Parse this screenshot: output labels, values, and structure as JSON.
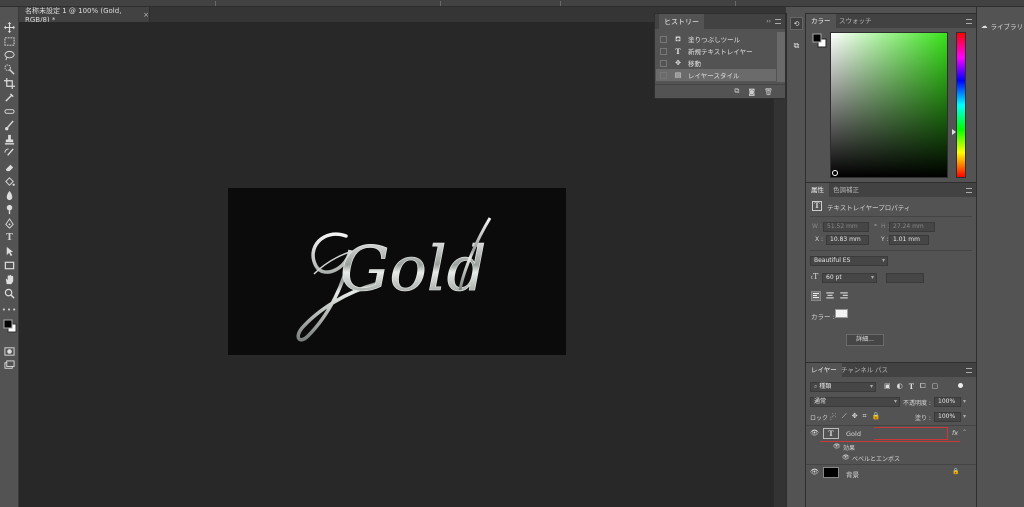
{
  "document": {
    "tab_title": "名称未設定 1 @ 100% (Gold, RGB/8) *",
    "close_label": "×",
    "text": "Gold"
  },
  "history": {
    "title": "ヒストリー",
    "items": [
      {
        "label": "塗りつぶしツール",
        "icon": "paint-bucket-icon"
      },
      {
        "label": "新規テキストレイヤー",
        "icon": "type-icon"
      },
      {
        "label": "移動",
        "icon": "move-icon"
      },
      {
        "label": "レイヤースタイル",
        "icon": "layer-style-icon"
      }
    ]
  },
  "color_panel": {
    "tabs": [
      "カラー",
      "スウォッチ"
    ],
    "hue": "#39e31a"
  },
  "properties": {
    "tabs": [
      "属性",
      "色調補正"
    ],
    "subtitle": "テキストレイヤープロパティ",
    "w_label": "W :",
    "w_value": "51.52 mm",
    "h_label": "H :",
    "h_value": "27.24 mm",
    "x_label": "X :",
    "x_value": "10.83 mm",
    "y_label": "Y :",
    "y_value": "1.01 mm",
    "font": "Beautiful ES",
    "size": "60 pt",
    "color_label": "カラー :",
    "detail_button": "詳細..."
  },
  "layers": {
    "tabs": [
      "レイヤー",
      "チャンネル",
      "パス"
    ],
    "filter": "種類",
    "blend": "通常",
    "opacity_label": "不透明度 :",
    "opacity": "100%",
    "lock_label": "ロック :",
    "fill_label": "塗り :",
    "fill": "100%",
    "rows": [
      {
        "name": "Gold"
      },
      {
        "name": "効果"
      },
      {
        "name": "ベベルとエンボス"
      },
      {
        "name": "背景"
      }
    ],
    "fx": "fx"
  },
  "library": {
    "label": "ライブラリ"
  }
}
